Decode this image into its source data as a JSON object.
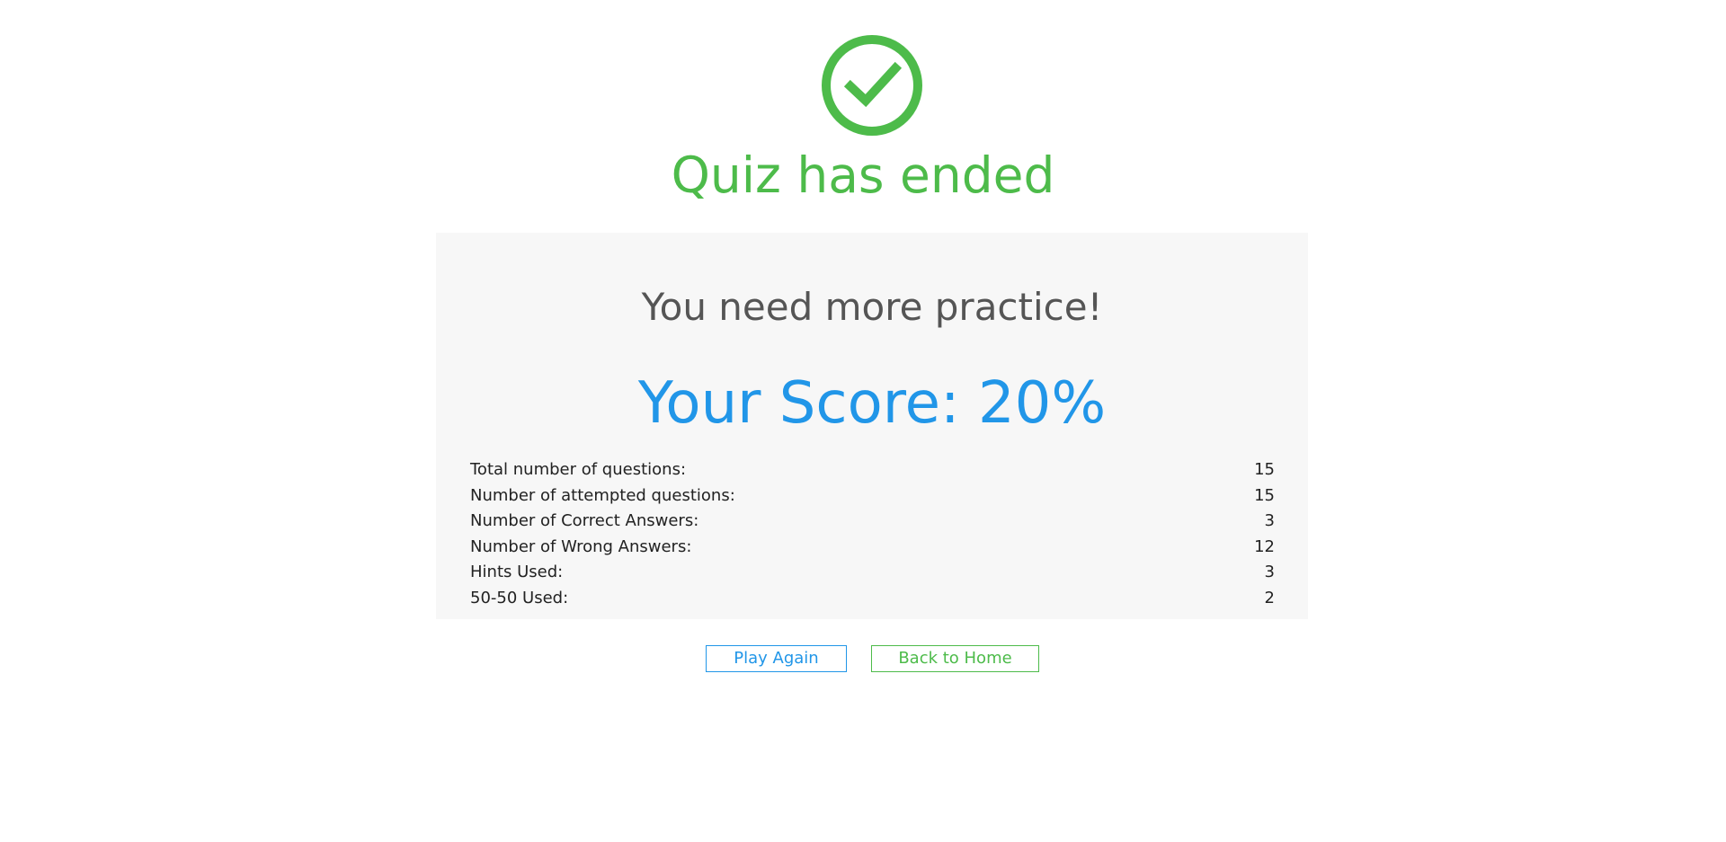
{
  "header": {
    "icon": "check-circle-icon",
    "title": "Quiz has ended"
  },
  "card": {
    "remark": "You need more practice!",
    "score_text": "Your Score: 20%",
    "stats": [
      {
        "label": "Total number of questions:",
        "value": "15"
      },
      {
        "label": "Number of attempted questions:",
        "value": "15"
      },
      {
        "label": "Number of Correct Answers:",
        "value": "3"
      },
      {
        "label": "Number of Wrong Answers:",
        "value": "12"
      },
      {
        "label": "Hints Used:",
        "value": "3"
      },
      {
        "label": "50-50 Used:",
        "value": "2"
      }
    ]
  },
  "actions": {
    "play_again": "Play Again",
    "back_home": "Back to Home"
  },
  "colors": {
    "success": "#4dbb4a",
    "score": "#2196e8",
    "card_bg": "#f7f7f7"
  }
}
